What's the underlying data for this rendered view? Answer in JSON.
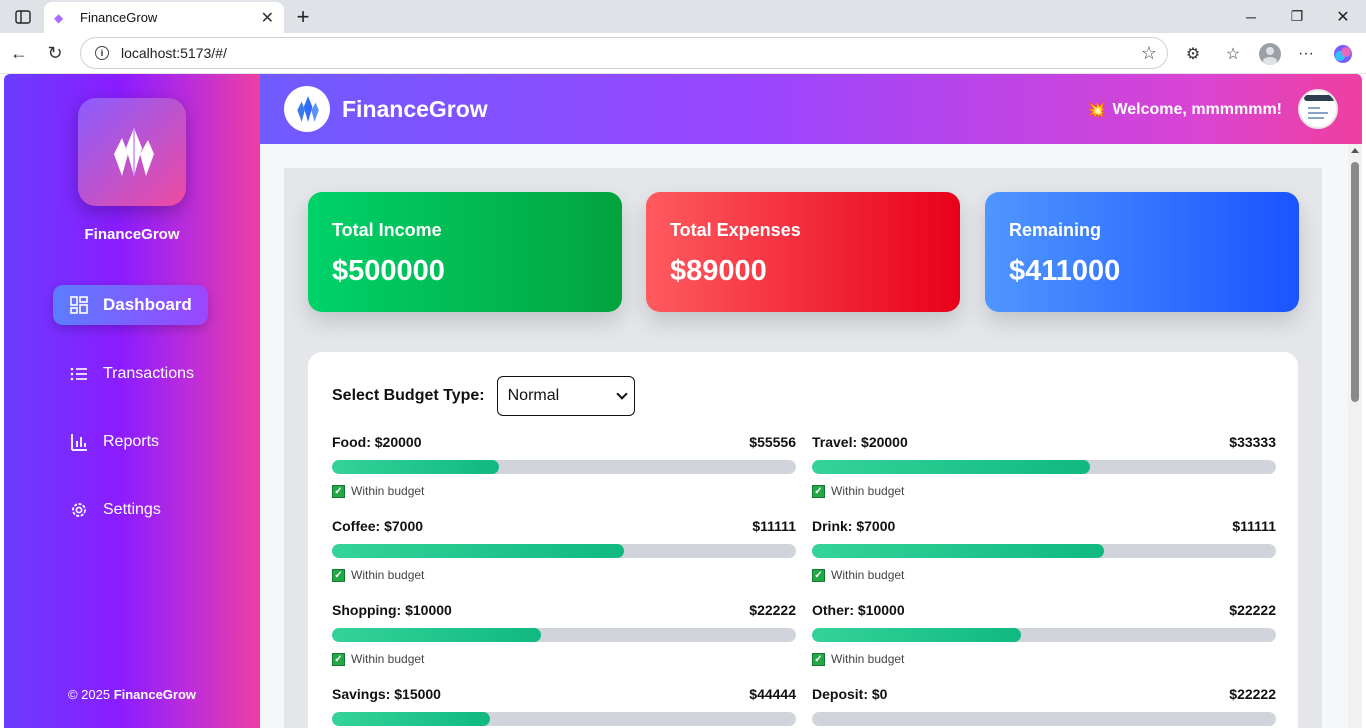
{
  "browser": {
    "tab_title": "FinanceGrow",
    "url": "localhost:5173/#/"
  },
  "sidebar": {
    "brand": "FinanceGrow",
    "items": [
      {
        "label": "Dashboard",
        "icon": "dashboard-icon",
        "active": true
      },
      {
        "label": "Transactions",
        "icon": "list-icon",
        "active": false
      },
      {
        "label": "Reports",
        "icon": "bar-chart-icon",
        "active": false
      },
      {
        "label": "Settings",
        "icon": "gear-icon",
        "active": false
      }
    ],
    "footer_prefix": "© 2025 ",
    "footer_brand": "FinanceGrow"
  },
  "topbar": {
    "title": "FinanceGrow",
    "welcome": "Welcome, mmmmmm!"
  },
  "summary": {
    "income_label": "Total Income",
    "income_value": "$500000",
    "expenses_label": "Total Expenses",
    "expenses_value": "$89000",
    "remaining_label": "Remaining",
    "remaining_value": "$411000"
  },
  "budget": {
    "select_label": "Select Budget Type:",
    "select_value": "Normal",
    "items": [
      {
        "name": "Food: $20000",
        "limit": "$55556",
        "progress": 0.36,
        "status": "Within budget"
      },
      {
        "name": "Travel: $20000",
        "limit": "$33333",
        "progress": 0.6,
        "status": "Within budget"
      },
      {
        "name": "Coffee: $7000",
        "limit": "$11111",
        "progress": 0.63,
        "status": "Within budget"
      },
      {
        "name": "Drink: $7000",
        "limit": "$11111",
        "progress": 0.63,
        "status": "Within budget"
      },
      {
        "name": "Shopping: $10000",
        "limit": "$22222",
        "progress": 0.45,
        "status": "Within budget"
      },
      {
        "name": "Other: $10000",
        "limit": "$22222",
        "progress": 0.45,
        "status": "Within budget"
      },
      {
        "name": "Savings: $15000",
        "limit": "$44444",
        "progress": 0.34,
        "status": ""
      },
      {
        "name": "Deposit: $0",
        "limit": "$22222",
        "progress": 0,
        "status": ""
      }
    ]
  },
  "colors": {
    "income": "#00c56a",
    "expenses": "#f03a3a",
    "remaining": "#2f6bff",
    "progress": "#10b981"
  }
}
